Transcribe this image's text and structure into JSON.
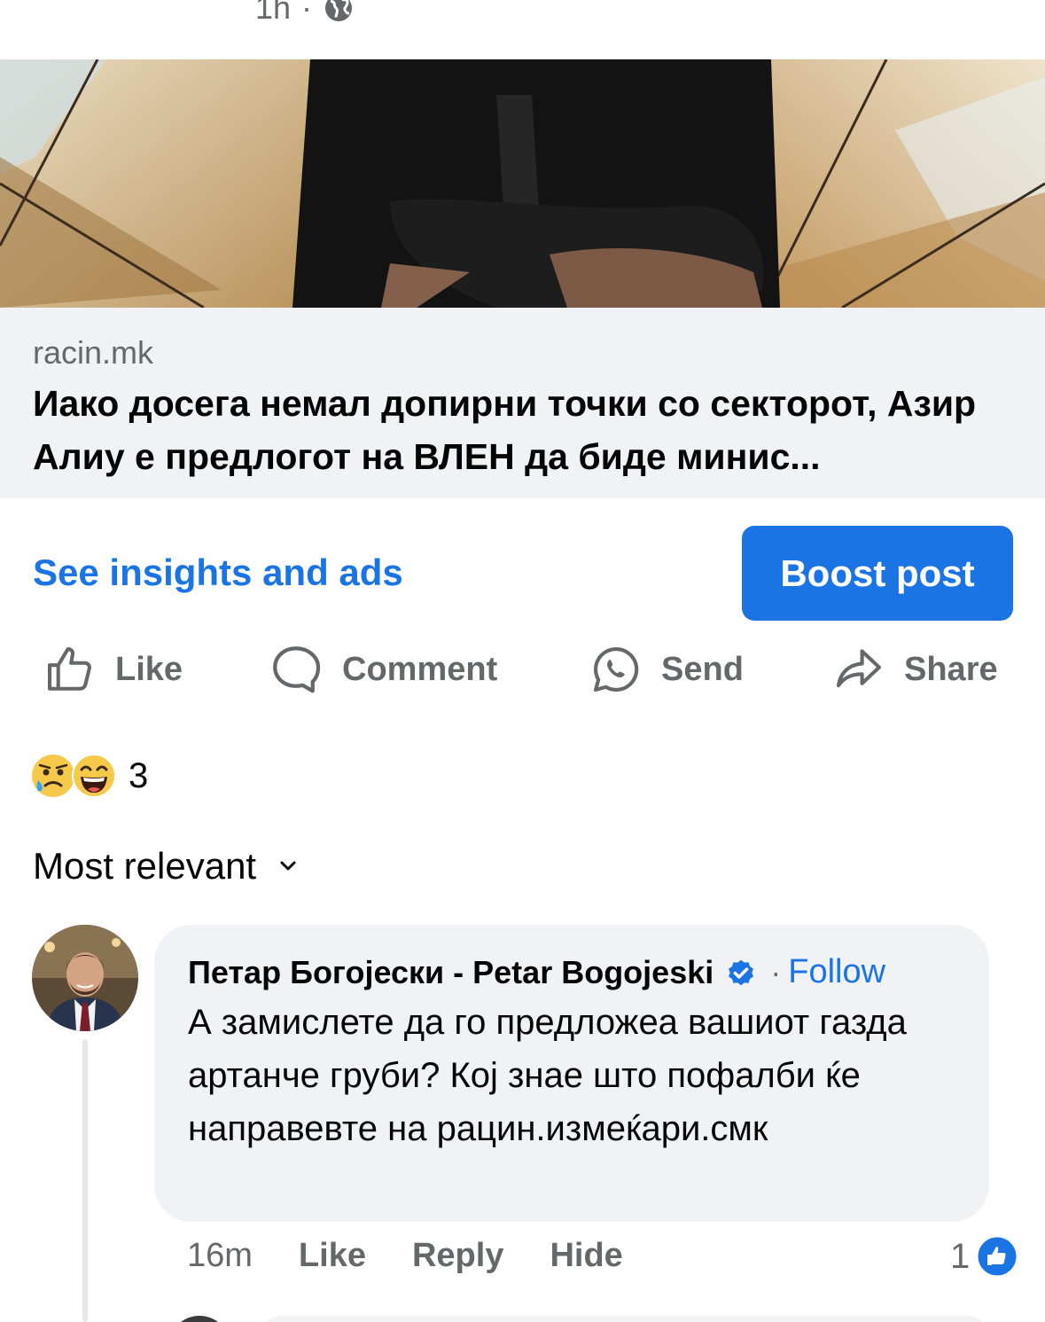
{
  "post": {
    "time": "1h",
    "separator": "·"
  },
  "link": {
    "domain": "racin.mk",
    "headline": "Иако досега немал допирни точки со секторот, Азир Алиу е предлогот на ВЛЕН да биде минис..."
  },
  "promo": {
    "insights_label": "See insights and ads",
    "boost_label": "Boost post"
  },
  "actions": {
    "like": "Like",
    "comment": "Comment",
    "send": "Send",
    "share": "Share"
  },
  "reactions": {
    "count": "3",
    "types": [
      "sad-emoji",
      "laughing-emoji"
    ]
  },
  "sort": {
    "label": "Most relevant"
  },
  "comment": {
    "author": "Петар Богојески - Petar Bogojeski",
    "separator": "·",
    "follow_label": "Follow",
    "text": "А замислете да го предложеа вашиот газда артанче груби? Кој знае што пофалби ќе направевте на рацин.измеќари.смк",
    "time": "16m",
    "like_label": "Like",
    "reply_label": "Reply",
    "hide_label": "Hide",
    "like_count": "1"
  },
  "colors": {
    "accent": "#1b74e4",
    "muted": "#65676b",
    "bubble": "#f0f2f5"
  }
}
